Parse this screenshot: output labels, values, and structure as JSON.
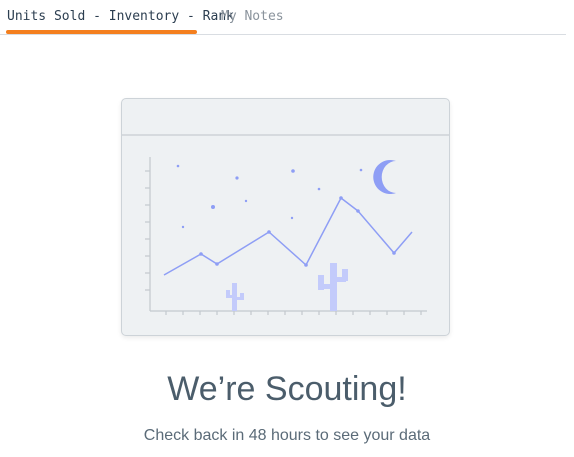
{
  "tabs": [
    {
      "label": "Units Sold - Inventory - Rank",
      "active": true
    },
    {
      "label": "My Notes",
      "active": false
    }
  ],
  "empty_state": {
    "title": "We’re Scouting!",
    "message": "Check back in 48 hours to see your data"
  },
  "illustration": {
    "subject": "line chart with stars, crescent moon and cacti",
    "icons": [
      "crescent-moon-icon",
      "star-icon",
      "cactus-icon"
    ]
  },
  "colors": {
    "accent": "#f47f1e",
    "title_text": "#4b5d6b",
    "body_text": "#5b6b78",
    "illustration_line": "#8e9ef5",
    "illustration_fill": "#eef1f3"
  }
}
